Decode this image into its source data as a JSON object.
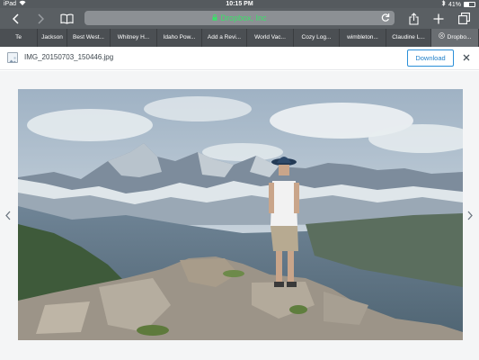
{
  "status_bar": {
    "device": "iPad",
    "time": "10:15 PM",
    "battery": "41%",
    "battery_level": 0.41
  },
  "toolbar": {
    "url": "Dropbox, Inc",
    "secure_color": "#3ce06a"
  },
  "tabs": [
    {
      "label": "Te"
    },
    {
      "label": "Jackson"
    },
    {
      "label": "Best West..."
    },
    {
      "label": "Whitney H..."
    },
    {
      "label": "Idaho Pow..."
    },
    {
      "label": "Add a Revi..."
    },
    {
      "label": "World Vac..."
    },
    {
      "label": "Cozy Log..."
    },
    {
      "label": "wimbleton..."
    },
    {
      "label": "Claudine L..."
    },
    {
      "label": "Dropbo..."
    }
  ],
  "preview": {
    "file_name": "IMG_20150703_150446.jpg",
    "download_label": "Download",
    "accent_color": "#2a8fd8"
  },
  "icons": {
    "back": "chevron-left-icon",
    "forward": "chevron-right-icon",
    "bookmarks": "book-icon",
    "lock": "lock-icon",
    "reload": "reload-icon",
    "share": "share-icon",
    "new_tab": "plus-icon",
    "tabs": "tabs-icon",
    "close": "close-icon",
    "prev": "chevron-left-icon",
    "next": "chevron-right-icon"
  }
}
